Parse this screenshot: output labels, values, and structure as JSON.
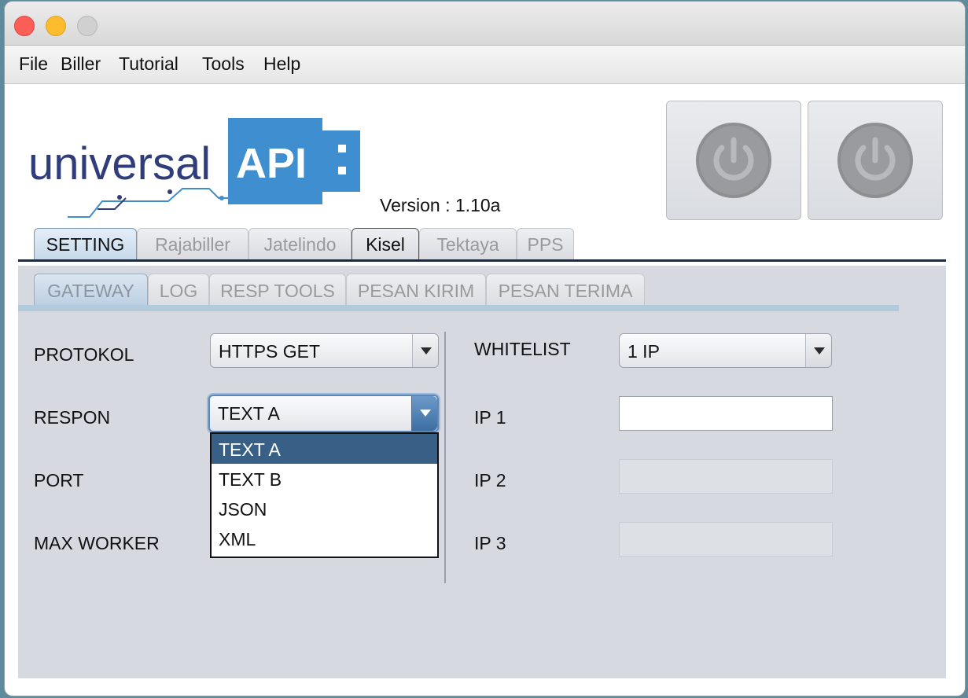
{
  "menubar": {
    "items": [
      "File",
      "Biller",
      "Tutorial",
      "Tools",
      "Help"
    ]
  },
  "logo": {
    "brand_text": "universal",
    "api_text": "API",
    "icon": "usb-plug-logo"
  },
  "version_text": "Version : 1.10a",
  "power_buttons": [
    {
      "icon": "power-icon"
    },
    {
      "icon": "power-icon"
    }
  ],
  "main_tabs": [
    "SETTING",
    "Rajabiller",
    "Jatelindo",
    "Kisel",
    "Tektaya",
    "PPS"
  ],
  "sub_tabs": [
    "GATEWAY",
    "LOG",
    "RESP TOOLS",
    "PESAN KIRIM",
    "PESAN TERIMA"
  ],
  "left_form": {
    "protokol_label": "PROTOKOL",
    "protokol_value": "HTTPS GET",
    "respon_label": "RESPON",
    "respon_value": "TEXT A",
    "port_label": "PORT",
    "max_worker_label": "MAX WORKER"
  },
  "respon_options": [
    "TEXT A",
    "TEXT B",
    "JSON",
    "XML"
  ],
  "right_form": {
    "whitelist_label": "WHITELIST",
    "whitelist_value": "1 IP",
    "ip1_label": "IP 1",
    "ip2_label": "IP 2",
    "ip3_label": "IP 3"
  },
  "colors": {
    "accent_blue": "#3f8fd0",
    "logo_navy": "#2f3d7a",
    "selection": "#385f85"
  }
}
